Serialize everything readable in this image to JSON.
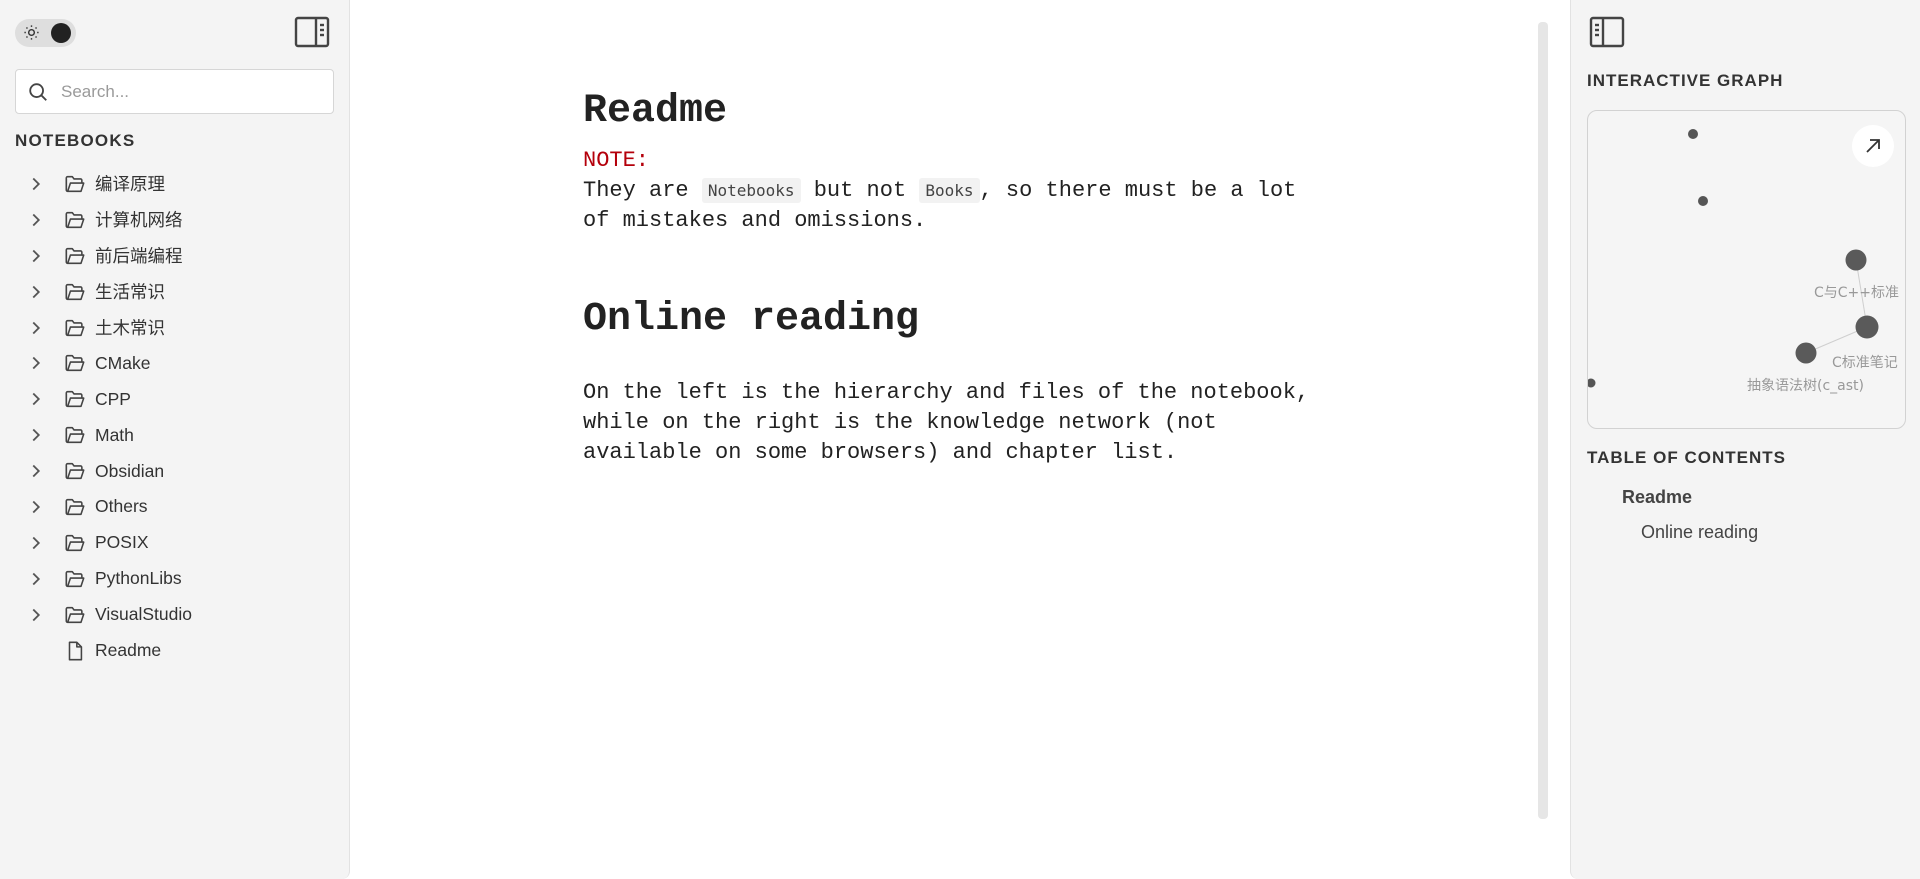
{
  "sidebar": {
    "search_placeholder": "Search...",
    "notebooks_heading": "NOTEBOOKS",
    "items": [
      {
        "label": "编译原理",
        "type": "folder"
      },
      {
        "label": "计算机网络",
        "type": "folder"
      },
      {
        "label": "前后端编程",
        "type": "folder"
      },
      {
        "label": "生活常识",
        "type": "folder"
      },
      {
        "label": "土木常识",
        "type": "folder"
      },
      {
        "label": "CMake",
        "type": "folder"
      },
      {
        "label": "CPP",
        "type": "folder"
      },
      {
        "label": "Math",
        "type": "folder"
      },
      {
        "label": "Obsidian",
        "type": "folder"
      },
      {
        "label": "Others",
        "type": "folder"
      },
      {
        "label": "POSIX",
        "type": "folder"
      },
      {
        "label": "PythonLibs",
        "type": "folder"
      },
      {
        "label": "VisualStudio",
        "type": "folder"
      },
      {
        "label": "Readme",
        "type": "file"
      }
    ]
  },
  "article": {
    "title": "Readme",
    "note_label": "NOTE:",
    "note_text_1": "They are ",
    "code_1": "Notebooks",
    "note_text_2": " but not ",
    "code_2": "Books",
    "note_text_3": ", so there must be a lot of mistakes and omissions.",
    "section_title": "Online reading",
    "section_text": "On the left is the hierarchy and files of the notebook, while on the right is the knowledge network (not available on some browsers) and chapter list."
  },
  "right_panel": {
    "graph_heading": "INTERACTIVE GRAPH",
    "graph_nodes": [
      {
        "label": "C与C++标准"
      },
      {
        "label": "C标准笔记"
      },
      {
        "label": "抽象语法树(c_ast)"
      }
    ],
    "toc_heading": "TABLE OF CONTENTS",
    "toc_items": [
      "Readme",
      "Online reading"
    ]
  }
}
